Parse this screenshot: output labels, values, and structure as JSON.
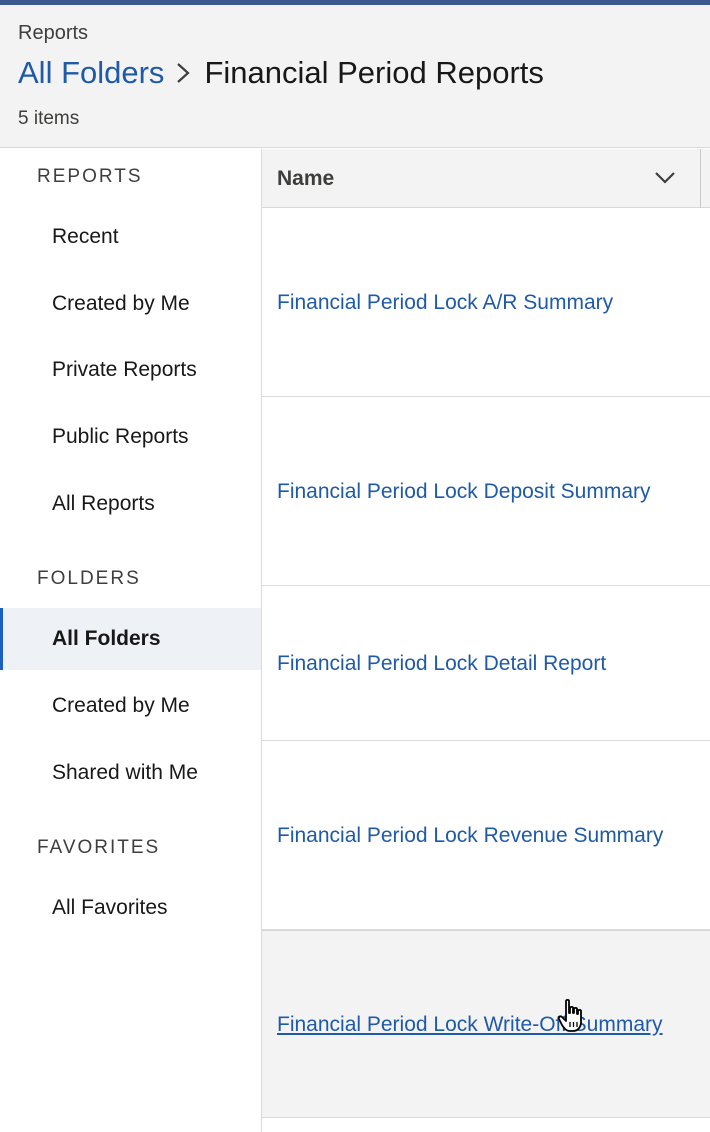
{
  "header": {
    "object_label": "Reports",
    "breadcrumb_link": "All Folders",
    "breadcrumb_current": "Financial Period Reports",
    "item_count": "5 items"
  },
  "sidebar": {
    "reports_section": "REPORTS",
    "reports_items": [
      "Recent",
      "Created by Me",
      "Private Reports",
      "Public Reports",
      "All Reports"
    ],
    "folders_section": "FOLDERS",
    "folders_items": [
      "All Folders",
      "Created by Me",
      "Shared with Me"
    ],
    "favorites_section": "FAVORITES",
    "favorites_items": [
      "All Favorites"
    ],
    "active_item": "All Folders"
  },
  "table": {
    "column_name": "Name",
    "rows": [
      {
        "name": "Financial Period Lock A/R Summary"
      },
      {
        "name": "Financial Period Lock Deposit Summary"
      },
      {
        "name": "Financial Period Lock Detail Report"
      },
      {
        "name": "Financial Period Lock Revenue Summary"
      },
      {
        "name": "Financial Period Lock Write-Off Summary"
      }
    ],
    "hovered_row": 5
  },
  "colors": {
    "accent": "#1b5fc1",
    "link": "#1f5aa8",
    "header_bg": "#f3f3f3",
    "top_bar": "#3d5a8f"
  }
}
